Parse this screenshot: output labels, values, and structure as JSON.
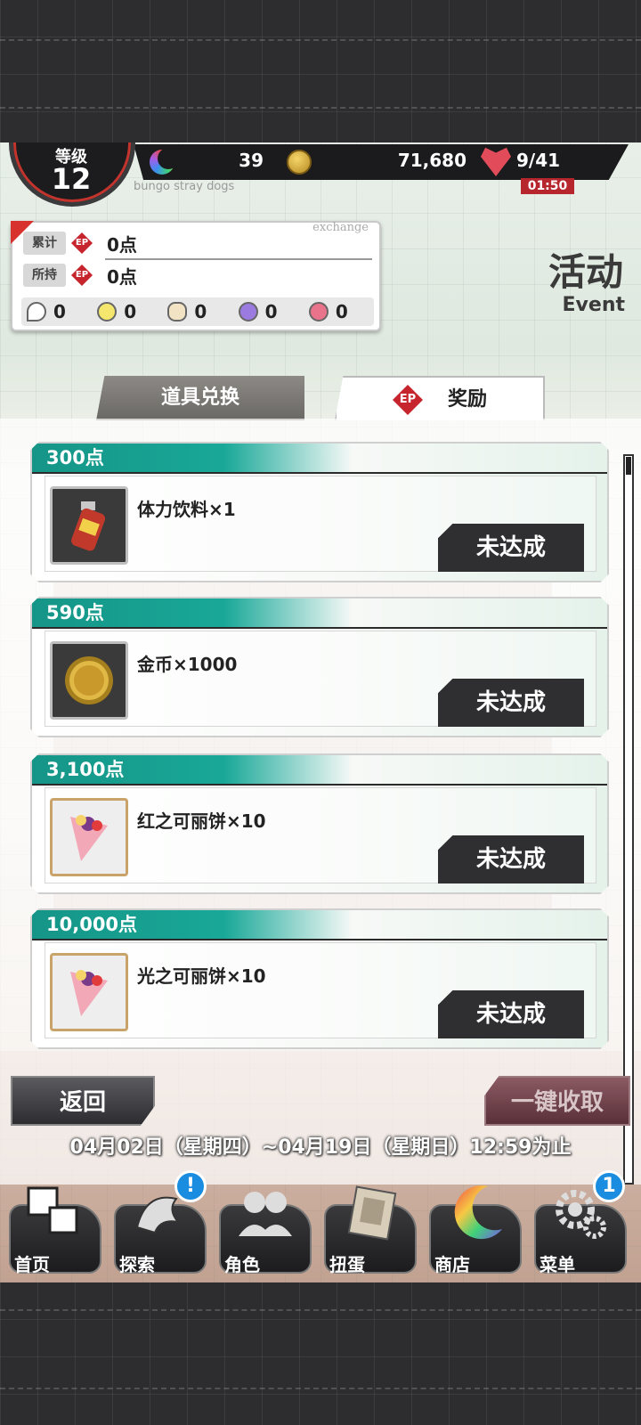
{
  "header": {
    "level_label": "等级",
    "level": "12",
    "gems": "39",
    "coins": "71,680",
    "stamina": "9/41",
    "timer": "01:50",
    "subtitle": "bungo stray dogs"
  },
  "points_panel": {
    "exchange_label": "exchange",
    "total_label": "累计",
    "total_value": "0点",
    "held_label": "所持",
    "held_value": "0点",
    "ep_icon": "EP",
    "items": [
      {
        "icon": "key-icon",
        "value": "0"
      },
      {
        "icon": "trophy-icon",
        "value": "0"
      },
      {
        "icon": "pouch-icon",
        "value": "0"
      },
      {
        "icon": "medal-icon",
        "value": "0"
      },
      {
        "icon": "potion-icon",
        "value": "0"
      }
    ]
  },
  "event": {
    "title": "活动",
    "subtitle": "Event"
  },
  "tabs": {
    "exchange": "道具兑换",
    "rewards": "奖励",
    "rewards_icon": "EP"
  },
  "rewards": [
    {
      "points": "300点",
      "name": "体力饮料×1",
      "status": "未达成",
      "icon": "drink-icon"
    },
    {
      "points": "590点",
      "name": "金币×1000",
      "status": "未达成",
      "icon": "coin-icon"
    },
    {
      "points": "3,100点",
      "name": "红之可丽饼×10",
      "status": "未达成",
      "icon": "crepe-icon"
    },
    {
      "points": "10,000点",
      "name": "光之可丽饼×10",
      "status": "未达成",
      "icon": "crepe-icon"
    }
  ],
  "actions": {
    "back": "返回",
    "collect_all": "一键收取"
  },
  "period": "04月02日（星期四）~04月19日（星期日）12:59为止",
  "nav": [
    {
      "label": "首页",
      "icon": "home-icon",
      "badge": ""
    },
    {
      "label": "探索",
      "icon": "explore-icon",
      "badge": "!"
    },
    {
      "label": "角色",
      "icon": "characters-icon",
      "badge": ""
    },
    {
      "label": "扭蛋",
      "icon": "gacha-icon",
      "badge": ""
    },
    {
      "label": "商店",
      "icon": "shop-icon",
      "badge": ""
    },
    {
      "label": "菜单",
      "icon": "menu-gear-icon",
      "badge": "1"
    }
  ],
  "colors": {
    "accent_teal": "#19a898",
    "accent_red": "#c7252e",
    "dark": "#2f2f31"
  }
}
